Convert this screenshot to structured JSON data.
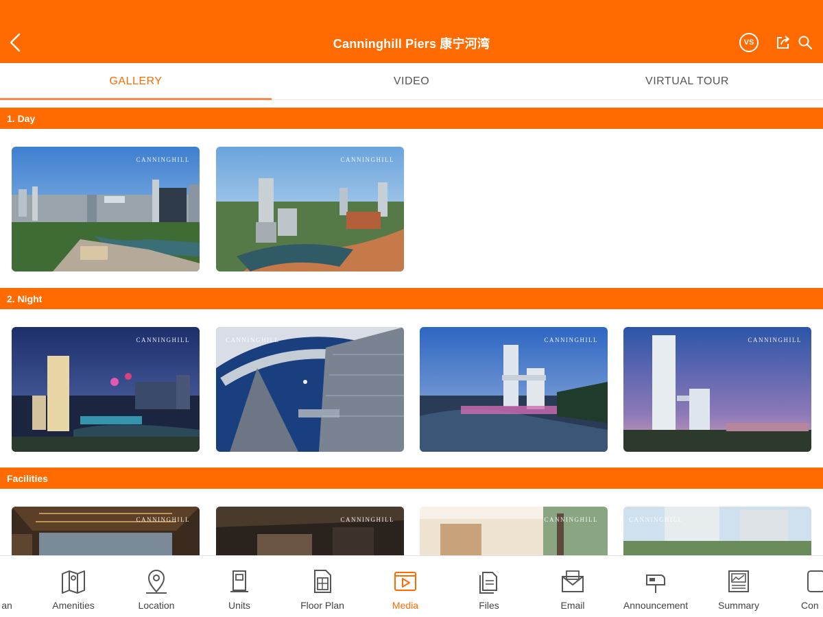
{
  "header": {
    "title": "Canninghill Piers 康宁河湾",
    "vs_label": "VS",
    "icons": [
      "back-chevron-icon",
      "vs-compare-icon",
      "share-icon",
      "search-icon"
    ]
  },
  "tabs": [
    {
      "label": "GALLERY",
      "active": true
    },
    {
      "label": "VIDEO",
      "active": false
    },
    {
      "label": "VIRTUAL TOUR",
      "active": false
    }
  ],
  "sections": [
    {
      "label": "1. Day"
    },
    {
      "label": "2. Night"
    },
    {
      "label": "Facilities"
    }
  ],
  "watermark": "CANNINGHILL",
  "bottom_nav": [
    {
      "label": "an",
      "icon": "plan-icon"
    },
    {
      "label": "Amenities",
      "icon": "map-icon"
    },
    {
      "label": "Location",
      "icon": "location-pin-icon"
    },
    {
      "label": "Units",
      "icon": "unit-door-icon"
    },
    {
      "label": "Floor Plan",
      "icon": "floor-plan-icon"
    },
    {
      "label": "Media",
      "icon": "media-play-icon",
      "active": true
    },
    {
      "label": "Files",
      "icon": "files-icon"
    },
    {
      "label": "Email",
      "icon": "email-icon"
    },
    {
      "label": "Announcement",
      "icon": "announcement-mailbox-icon"
    },
    {
      "label": "Summary",
      "icon": "summary-icon"
    },
    {
      "label": "Con",
      "icon": "contact-phone-icon"
    }
  ],
  "colors": {
    "brand": "#ff6b00",
    "active_text": "#ff6b00",
    "inactive_text": "#555555"
  }
}
